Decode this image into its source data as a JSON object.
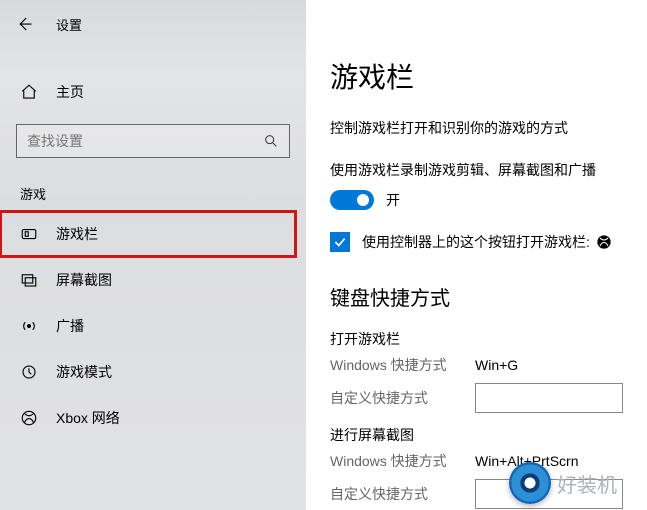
{
  "header": {
    "title": "设置"
  },
  "sidebar": {
    "home_label": "主页",
    "search_placeholder": "查找设置",
    "section_label": "游戏",
    "items": [
      {
        "label": "游戏栏"
      },
      {
        "label": "屏幕截图"
      },
      {
        "label": "广播"
      },
      {
        "label": "游戏模式"
      },
      {
        "label": "Xbox 网络"
      }
    ]
  },
  "main": {
    "title": "游戏栏",
    "description": "控制游戏栏打开和识别你的游戏的方式",
    "toggle_desc": "使用游戏栏录制游戏剪辑、屏幕截图和广播",
    "toggle_label": "开",
    "checkbox_label": "使用控制器上的这个按钮打开游戏栏:",
    "shortcuts_heading": "键盘快捷方式",
    "shortcut_groups": [
      {
        "title": "打开游戏栏",
        "rows": [
          {
            "label": "Windows 快捷方式",
            "value": "Win+G"
          },
          {
            "label": "自定义快捷方式",
            "value": ""
          }
        ]
      },
      {
        "title": "进行屏幕截图",
        "rows": [
          {
            "label": "Windows 快捷方式",
            "value": "Win+Alt+PrtScrn"
          },
          {
            "label": "自定义快捷方式",
            "value": ""
          }
        ]
      }
    ]
  },
  "watermark": {
    "text": "好装机"
  }
}
